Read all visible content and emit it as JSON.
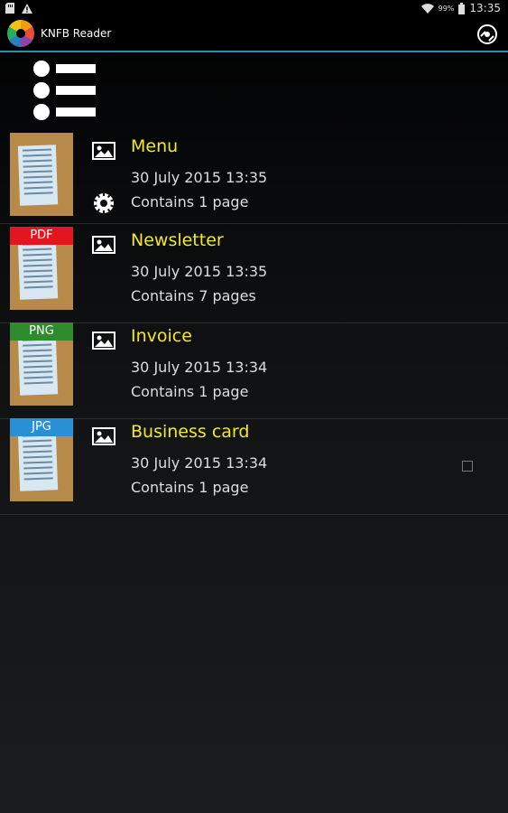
{
  "status_bar": {
    "battery_percent": "99%",
    "time": "13:35",
    "icons": [
      "sd-card-icon",
      "warning-icon",
      "wifi-icon",
      "battery-icon"
    ]
  },
  "app_bar": {
    "title": "KNFB Reader",
    "logo_icon": "knfb-logo-icon",
    "settings_icon": "disc-settings-icon"
  },
  "toolbar": {
    "menu_icon": "list-icon"
  },
  "documents": [
    {
      "title": "Menu",
      "date": "30 July 2015 13:35",
      "pages": "Contains 1 page",
      "badge": "",
      "badge_color": "",
      "processing": true
    },
    {
      "title": "Newsletter",
      "date": "30 July 2015 13:35",
      "pages": "Contains 7 pages",
      "badge": "PDF",
      "badge_color": "#e3161f",
      "processing": false
    },
    {
      "title": "Invoice",
      "date": "30 July 2015 13:34",
      "pages": "Contains 1 page",
      "badge": "PNG",
      "badge_color": "#2e8b2e",
      "processing": false
    },
    {
      "title": "Business card",
      "date": "30 July 2015 13:34",
      "pages": "Contains 1 page",
      "badge": "JPG",
      "badge_color": "#2b8fd6",
      "processing": false
    }
  ],
  "colors": {
    "accent_line": "#2a8fb0",
    "title_text": "#f3ea1c"
  }
}
